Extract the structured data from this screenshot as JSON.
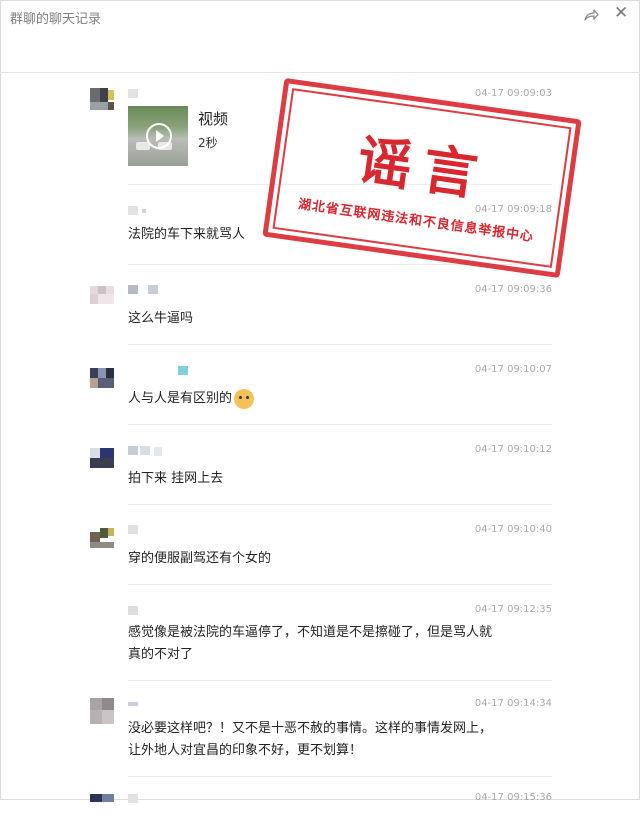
{
  "window": {
    "title": "群聊的聊天记录",
    "share_icon": "share-icon",
    "close_icon": "close-icon",
    "close_glyph": "✕"
  },
  "messages": [
    {
      "time": "04-17 09:09:03",
      "type": "video",
      "video_label": "视频",
      "duration": "2秒"
    },
    {
      "time": "04-17 09:09:18",
      "text": "法院的车下来就骂人"
    },
    {
      "time": "04-17 09:09:36",
      "text": "这么牛逼吗"
    },
    {
      "time": "04-17 09:10:07",
      "text": "人与人是有区别的",
      "emoji": "doge-emoji"
    },
    {
      "time": "04-17 09:10:12",
      "text": "拍下来 挂网上去"
    },
    {
      "time": "04-17 09:10:40",
      "text": "穿的便服副驾还有个女的"
    },
    {
      "time": "04-17 09:12:35",
      "text_lines": [
        "感觉像是被法院的车逼停了，不知道是不是擦碰了，但是骂人就",
        "真的不对了"
      ]
    },
    {
      "time": "04-17 09:14:34",
      "text_lines": [
        "没必要这样吧？！又不是十恶不赦的事情。这样的事情发网上，",
        "让外地人对宜昌的印象不好，更不划算！"
      ]
    },
    {
      "time": "04-17 09:15:36"
    }
  ],
  "stamp": {
    "main": "谣言",
    "sub": "湖北省互联网违法和不良信息举报中心",
    "color": "#d8272e"
  }
}
